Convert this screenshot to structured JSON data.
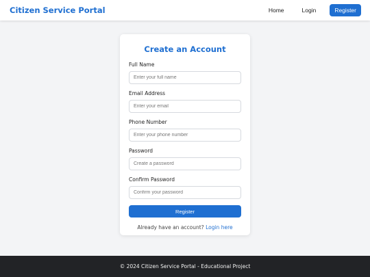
{
  "header": {
    "brand": "Citizen Service Portal",
    "nav": {
      "home": "Home",
      "login": "Login",
      "register": "Register"
    }
  },
  "form": {
    "title": "Create an Account",
    "fields": [
      {
        "label": "Full Name",
        "placeholder": "Enter your full name",
        "value": ""
      },
      {
        "label": "Email Address",
        "placeholder": "Enter your email",
        "value": ""
      },
      {
        "label": "Phone Number",
        "placeholder": "Enter your phone number",
        "value": ""
      },
      {
        "label": "Password",
        "placeholder": "Create a password",
        "value": ""
      },
      {
        "label": "Confirm Password",
        "placeholder": "Confirm your password",
        "value": ""
      }
    ],
    "submit_label": "Register",
    "login_prompt": "Already have an account?",
    "login_link": "Login here"
  },
  "footer": {
    "text": "© 2024 Citizen Service Portal - Educational Project"
  },
  "colors": {
    "accent": "#1f6fd1",
    "page_background": "#f3f4f6",
    "footer_background": "#222326"
  }
}
